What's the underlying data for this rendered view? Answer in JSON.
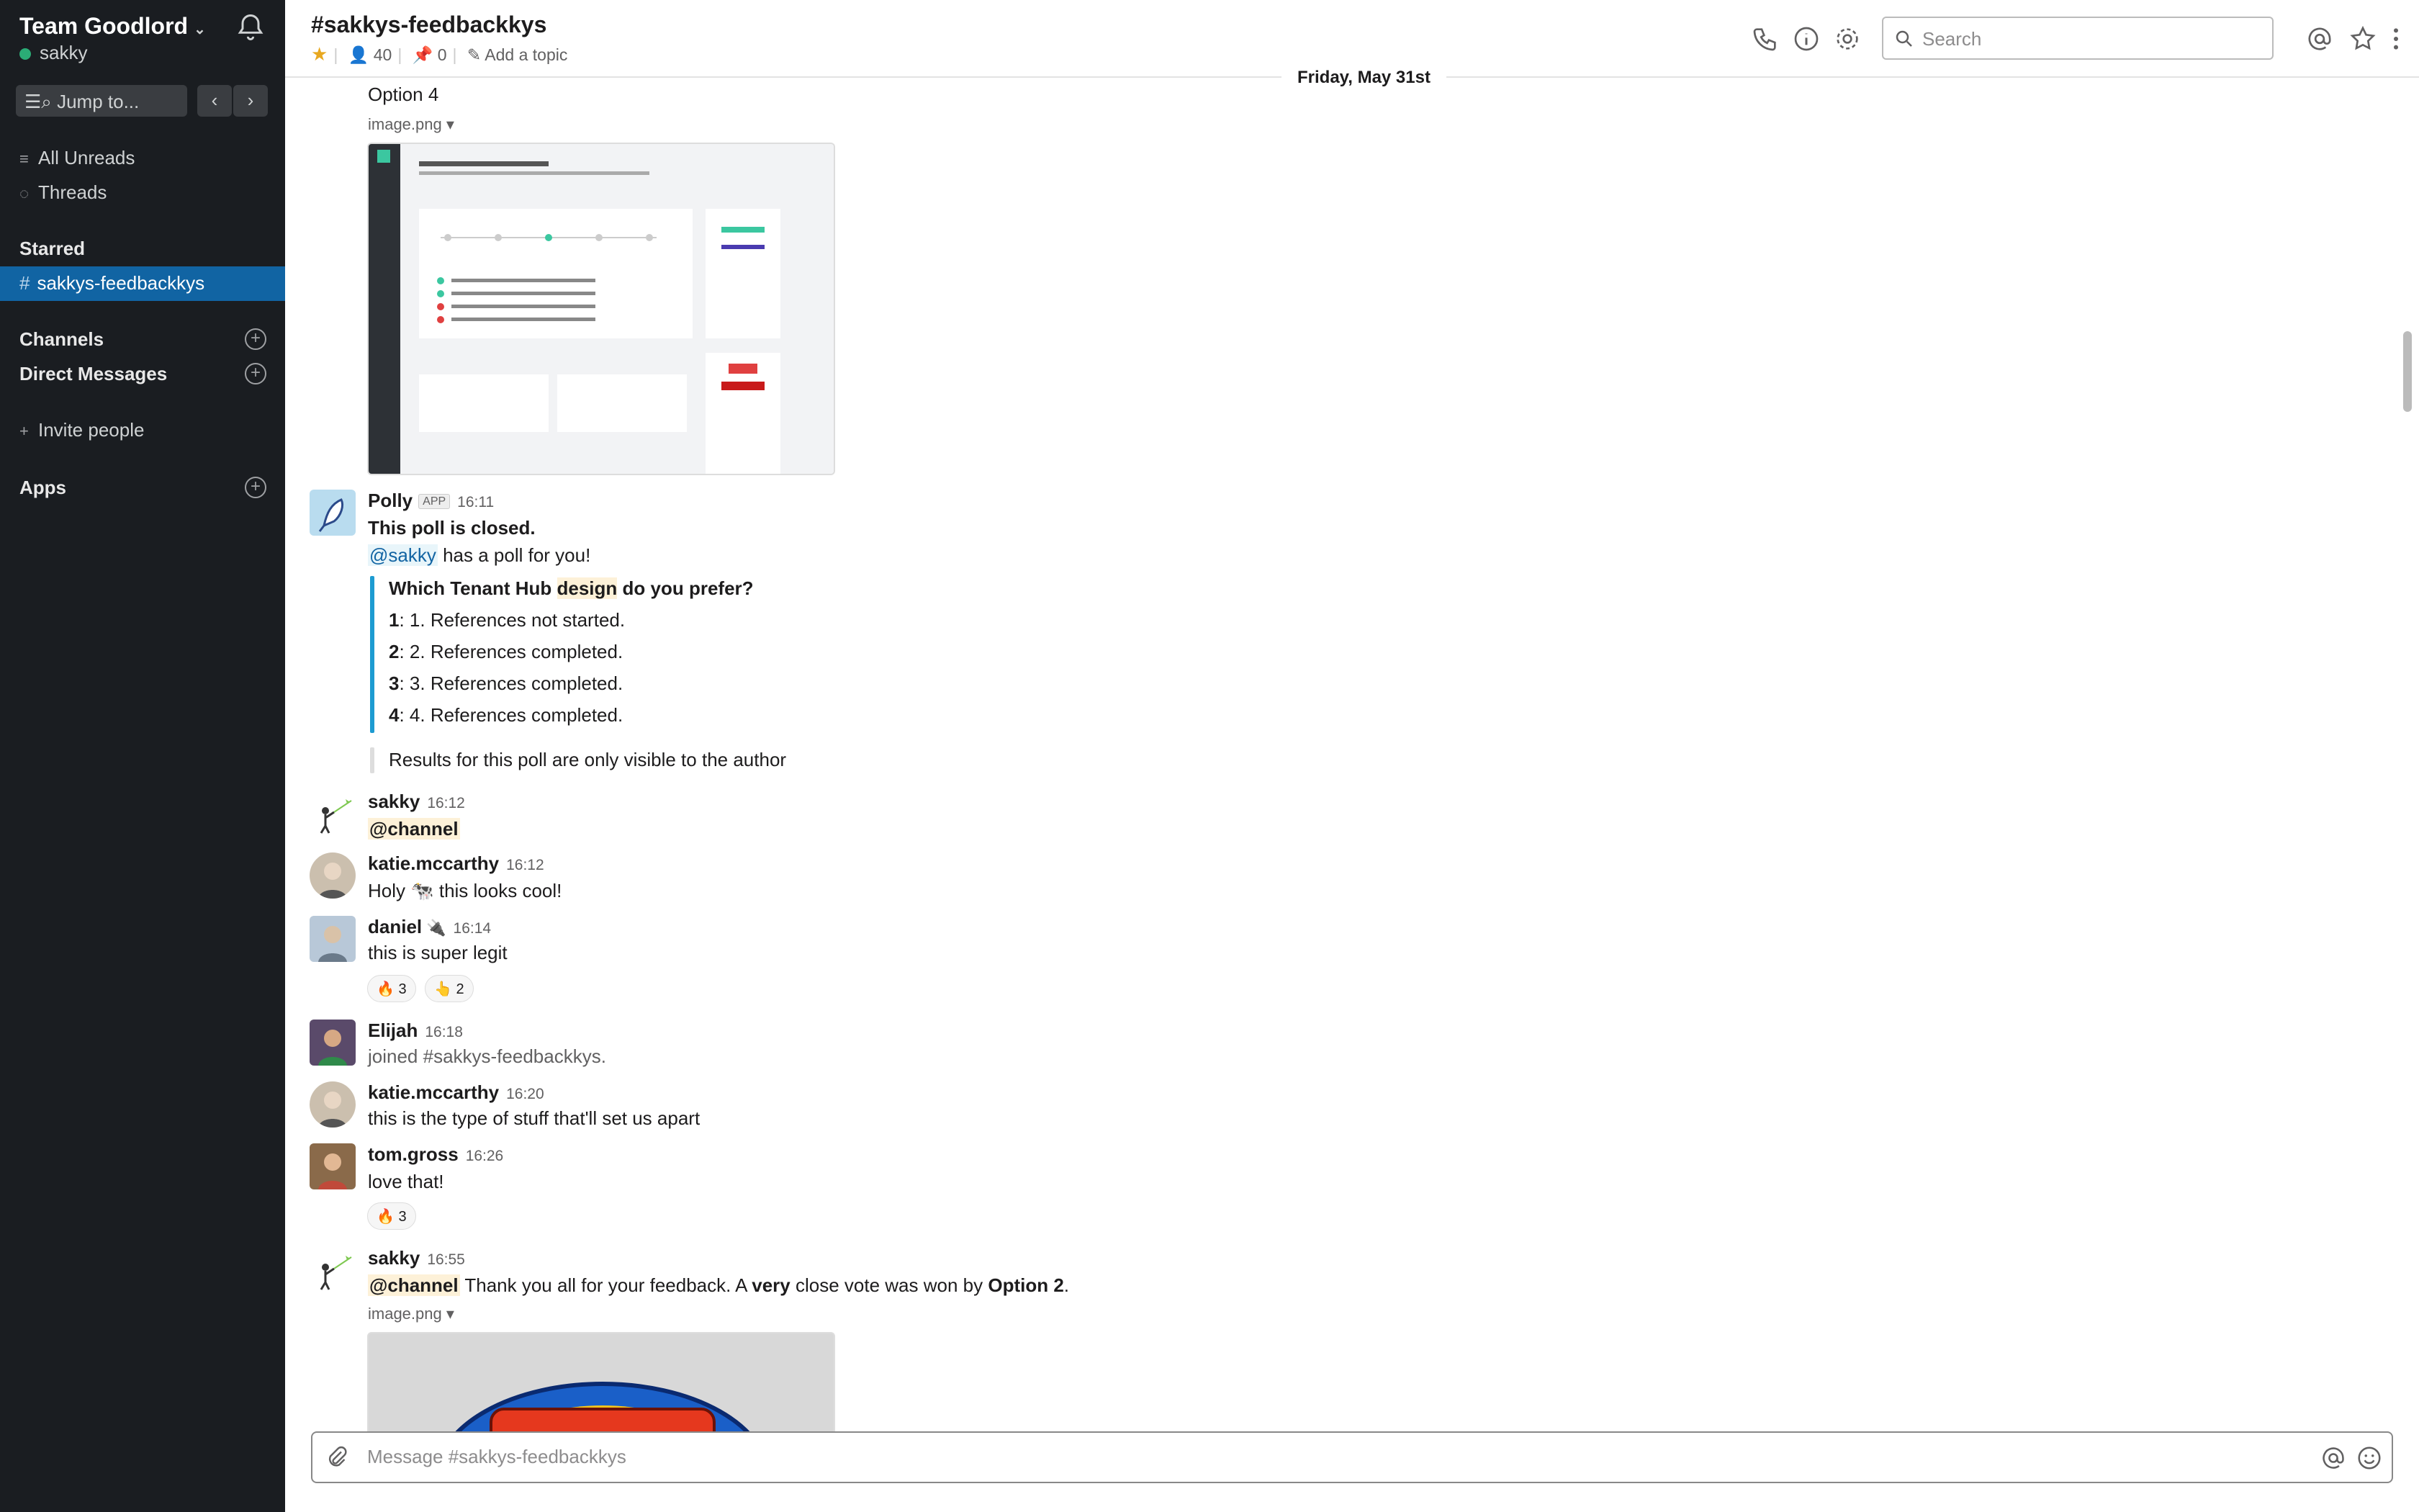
{
  "sidebar": {
    "team_name": "Team Goodlord",
    "user": "sakky",
    "jump_label": "Jump to...",
    "all_unreads": "All Unreads",
    "threads": "Threads",
    "starred_heading": "Starred",
    "starred_item": "sakkys-feedbackkys",
    "channels_heading": "Channels",
    "dm_heading": "Direct Messages",
    "invite": "Invite people",
    "apps_heading": "Apps",
    "hash": "#"
  },
  "header": {
    "channel": "#sakkys-feedbackkys",
    "members": "40",
    "pins": "0",
    "add_topic": "Add a topic",
    "search_placeholder": "Search"
  },
  "date_divider": "Friday, May 31st",
  "messages": {
    "option4": "Option 4",
    "file1": "image.png",
    "polly": {
      "name": "Polly",
      "badge": "APP",
      "time": "16:11",
      "closed": "This poll is closed.",
      "mention": "@sakky",
      "intro_rest": " has a poll for you!",
      "question_pre": "Which Tenant Hub ",
      "question_hl": "design",
      "question_post": " do you prefer?",
      "options": [
        {
          "num": "1",
          "text": ": 1. References not started."
        },
        {
          "num": "2",
          "text": ": 2. References completed."
        },
        {
          "num": "3",
          "text": ": 3. References completed."
        },
        {
          "num": "4",
          "text": ": 4. References completed."
        }
      ],
      "results_note": "Results for this poll are only visible to the author"
    },
    "m1": {
      "name": "sakky",
      "time": "16:12",
      "text": "@channel"
    },
    "m2": {
      "name": "katie.mccarthy",
      "time": "16:12",
      "pre": "Holy ",
      "emoji": "🐄",
      "post": " this looks cool!"
    },
    "m3": {
      "name": "daniel",
      "status": "🔌",
      "time": "16:14",
      "text": "this is super legit",
      "reactions": [
        {
          "emoji": "🔥",
          "count": "3"
        },
        {
          "emoji": "👆",
          "count": "2"
        }
      ]
    },
    "m4": {
      "name": "Elijah",
      "time": "16:18",
      "text": "joined #sakkys-feedbackkys."
    },
    "m5": {
      "name": "katie.mccarthy",
      "time": "16:20",
      "text": "this is the type of stuff that'll set us apart"
    },
    "m6": {
      "name": "tom.gross",
      "time": "16:26",
      "text": "love that!",
      "reactions": [
        {
          "emoji": "🔥",
          "count": "3"
        }
      ]
    },
    "m7": {
      "name": "sakky",
      "time": "16:55",
      "mention": "@channel",
      "t1": " Thank you all for your feedback. A ",
      "b1": "very",
      "t2": " close vote was won by ",
      "b2": "Option 2",
      "t3": ".",
      "file": "image.png"
    }
  },
  "composer": {
    "placeholder": "Message #sakkys-feedbackkys"
  },
  "colors": {
    "sidebar": "#1a1d21",
    "active": "#1164a3",
    "presence": "#2bac76",
    "poll_bar": "#1d9bd1"
  }
}
